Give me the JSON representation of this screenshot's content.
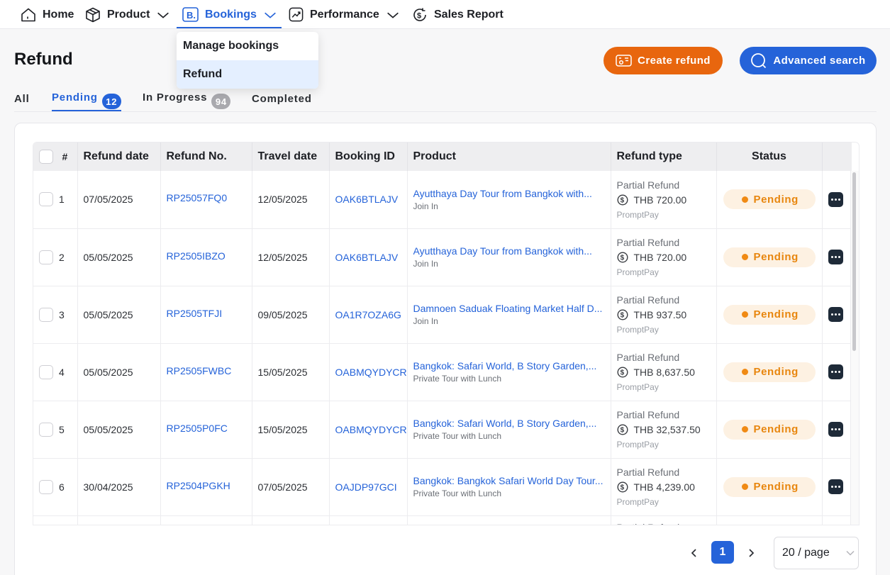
{
  "nav": {
    "home": "Home",
    "product": "Product",
    "bookings": "Bookings",
    "performance": "Performance",
    "sales_report": "Sales Report",
    "bookings_menu": [
      "Manage bookings",
      "Refund"
    ]
  },
  "page": {
    "title": "Refund",
    "create_refund": "Create refund",
    "advanced_search": "Advanced search"
  },
  "tabs": [
    {
      "label": "All",
      "count": ""
    },
    {
      "label": "Pending",
      "count": "12"
    },
    {
      "label": "In Progress",
      "count": "94"
    },
    {
      "label": "Completed",
      "count": ""
    }
  ],
  "table": {
    "headers": [
      "#",
      "Refund date",
      "Refund No.",
      "Travel date",
      "Booking ID",
      "Product",
      "Refund type",
      "Status"
    ],
    "rows": [
      {
        "num": "1",
        "refund_date": "07/05/2025",
        "refund_no": "RP25057FQ0",
        "travel_date": "12/05/2025",
        "booking_id": "OAK6BTLAJV",
        "product": "Ayutthaya Day Tour from Bangkok with...",
        "product_sub": "Join In",
        "refund_type": "Partial Refund",
        "amount": "THB 720.00",
        "payment": "PromptPay",
        "status": "Pending"
      },
      {
        "num": "2",
        "refund_date": "05/05/2025",
        "refund_no": "RP2505IBZO",
        "travel_date": "12/05/2025",
        "booking_id": "OAK6BTLAJV",
        "product": "Ayutthaya Day Tour from Bangkok with...",
        "product_sub": "Join In",
        "refund_type": "Partial Refund",
        "amount": "THB 720.00",
        "payment": "PromptPay",
        "status": "Pending"
      },
      {
        "num": "3",
        "refund_date": "05/05/2025",
        "refund_no": "RP2505TFJI",
        "travel_date": "09/05/2025",
        "booking_id": "OA1R7OZA6G",
        "product": "Damnoen Saduak Floating Market Half D...",
        "product_sub": "Join In",
        "refund_type": "Partial Refund",
        "amount": "THB 937.50",
        "payment": "PromptPay",
        "status": "Pending"
      },
      {
        "num": "4",
        "refund_date": "05/05/2025",
        "refund_no": "RP2505FWBC",
        "travel_date": "15/05/2025",
        "booking_id": "OABMQYDYCR",
        "product": "Bangkok: Safari World, B Story Garden,...",
        "product_sub": "Private Tour with Lunch",
        "refund_type": "Partial Refund",
        "amount": "THB 8,637.50",
        "payment": "PromptPay",
        "status": "Pending"
      },
      {
        "num": "5",
        "refund_date": "05/05/2025",
        "refund_no": "RP2505P0FC",
        "travel_date": "15/05/2025",
        "booking_id": "OABMQYDYCR",
        "product": "Bangkok: Safari World, B Story Garden,...",
        "product_sub": "Private Tour with Lunch",
        "refund_type": "Partial Refund",
        "amount": "THB 32,537.50",
        "payment": "PromptPay",
        "status": "Pending"
      },
      {
        "num": "6",
        "refund_date": "30/04/2025",
        "refund_no": "RP2504PGKH",
        "travel_date": "07/05/2025",
        "booking_id": "OAJDP97GCI",
        "product": "Bangkok: Bangkok Safari World Day Tour...",
        "product_sub": "Private Tour with Lunch",
        "refund_type": "Partial Refund",
        "amount": "THB 4,239.00",
        "payment": "PromptPay",
        "status": "Pending"
      },
      {
        "num": "",
        "refund_date": "",
        "refund_no": "",
        "travel_date": "",
        "booking_id": "",
        "product": "",
        "product_sub": "",
        "refund_type": "Partial Refund",
        "amount": "",
        "payment": "",
        "status": ""
      }
    ]
  },
  "pagination": {
    "current": "1",
    "page_size": "20 / page"
  }
}
